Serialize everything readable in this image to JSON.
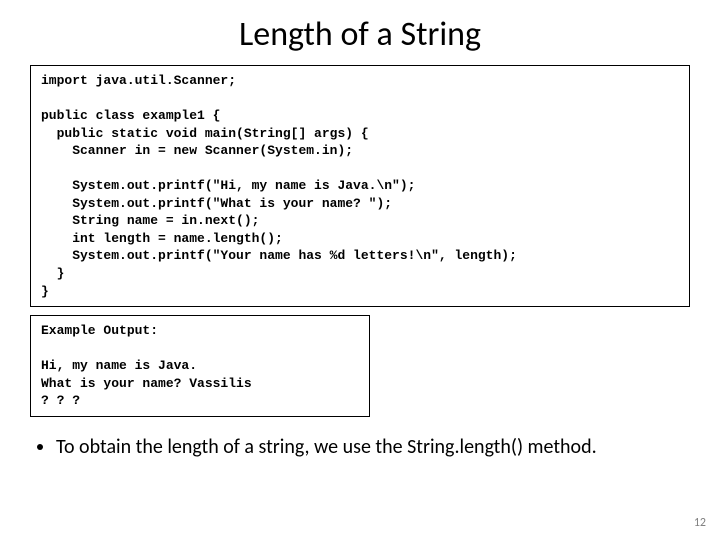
{
  "title": "Length of a String",
  "code": "import java.util.Scanner;\n\npublic class example1 {\n  public static void main(String[] args) {\n    Scanner in = new Scanner(System.in);\n\n    System.out.printf(\"Hi, my name is Java.\\n\");\n    System.out.printf(\"What is your name? \");\n    String name = in.next();\n    int length = name.length();\n    System.out.printf(\"Your name has %d letters!\\n\", length);\n  }\n}",
  "output": "Example Output:\n\nHi, my name is Java.\nWhat is your name? Vassilis\n? ? ?",
  "bullet": "To obtain the length of a string, we use the String.length() method.",
  "page_number": "12"
}
